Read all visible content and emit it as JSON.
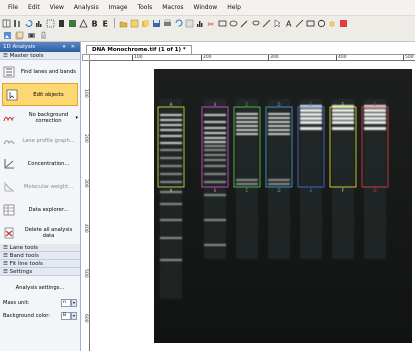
{
  "menu": [
    "File",
    "Edit",
    "View",
    "Analysis",
    "Image",
    "Tools",
    "Macros",
    "Window",
    "Help"
  ],
  "panel": {
    "title": "1D Analysis",
    "controls": "▾ ✕"
  },
  "sections": {
    "master_tools": "☰ Master tools",
    "lane_tools": "☰ Lane tools",
    "band_tools": "☰ Band tools",
    "fit_line_tools": "☰ Fit line tools",
    "settings": "☰ Settings"
  },
  "tools": [
    {
      "label": "Find lanes and bands",
      "icon": "find-lanes-icon",
      "state": "normal"
    },
    {
      "label": "Edit objects",
      "icon": "edit-objects-icon",
      "state": "active"
    },
    {
      "label": "No background correction",
      "icon": "background-icon",
      "state": "normal"
    },
    {
      "label": "Lane profile graph...",
      "icon": "profile-graph-icon",
      "state": "disabled"
    },
    {
      "label": "Concentration...",
      "icon": "concentration-icon",
      "state": "normal"
    },
    {
      "label": "Molecular weight...",
      "icon": "molecular-weight-icon",
      "state": "disabled"
    },
    {
      "label": "Data explorer...",
      "icon": "data-explorer-icon",
      "state": "normal"
    },
    {
      "label": "Delete all analysis data",
      "icon": "delete-icon",
      "state": "normal"
    }
  ],
  "settings": {
    "analysis_button": "Analysis settings...",
    "mass_unit_label": "Mass unit:",
    "mass_unit_value": "n",
    "background_color_label": "Background color:",
    "background_color_value": "B"
  },
  "document": {
    "tab_title": "DNA Monochrome.tif (1 of 1) *",
    "ruler_top_labels": [
      "100",
      "200",
      "300",
      "400",
      "500"
    ],
    "ruler_left_labels": [
      "100",
      "200",
      "300",
      "400",
      "500",
      "600"
    ]
  },
  "lanes": [
    {
      "letter": "A",
      "color": "#e7e84a"
    },
    {
      "letter": "B",
      "color": "#e05ad6"
    },
    {
      "letter": "C",
      "color": "#5fd35a"
    },
    {
      "letter": "D",
      "color": "#4aa8e0"
    },
    {
      "letter": "E",
      "color": "#4a78e8"
    },
    {
      "letter": "F",
      "color": "#f0ee3c"
    },
    {
      "letter": "G",
      "color": "#e84450"
    }
  ]
}
